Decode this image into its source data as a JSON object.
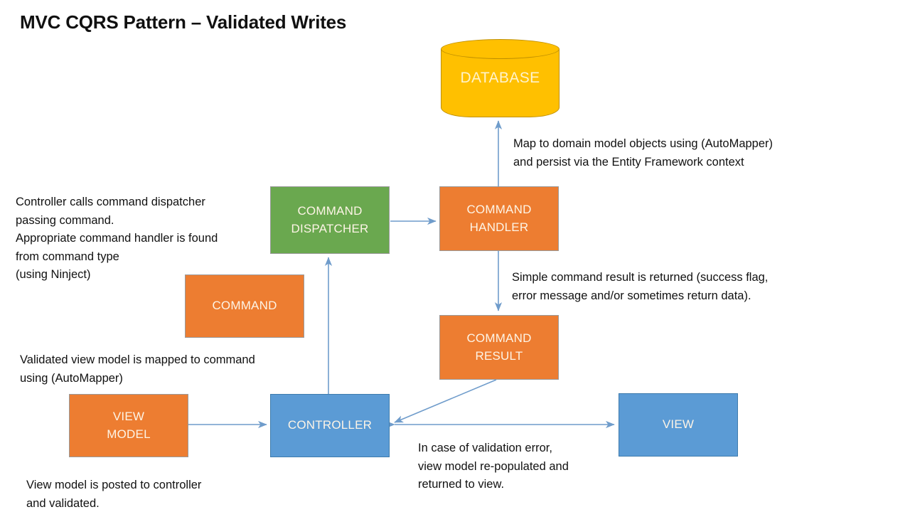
{
  "title": "MVC CQRS Pattern – Validated Writes",
  "colors": {
    "orange": "#ed7d31",
    "green": "#6aa84f",
    "blue": "#5b9bd5",
    "yellow": "#ffc000",
    "arrow": "#6f9ccb",
    "text_dark": "#111111",
    "node_text": "#fdf4e6"
  },
  "nodes": {
    "database": {
      "label": "DATABASE",
      "shape": "cylinder",
      "color": "#ffc000"
    },
    "command_dispatcher": {
      "line1": "COMMAND",
      "line2": "DISPATCHER",
      "color": "#6aa84f"
    },
    "command_handler": {
      "line1": "COMMAND",
      "line2": "HANDLER",
      "color": "#ed7d31"
    },
    "command": {
      "line1": "COMMAND",
      "color": "#ed7d31"
    },
    "command_result": {
      "line1": "COMMAND",
      "line2": "RESULT",
      "color": "#ed7d31"
    },
    "view_model": {
      "line1": "VIEW",
      "line2": "MODEL",
      "color": "#ed7d31"
    },
    "controller": {
      "line1": "CONTROLLER",
      "color": "#5b9bd5"
    },
    "view": {
      "line1": "VIEW",
      "color": "#5b9bd5"
    }
  },
  "notes": {
    "controller_dispatch": "Controller calls command dispatcher\npassing command.\nAppropriate command handler is found\nfrom command type\n(using Ninject)",
    "persist": "Map to domain model objects using (AutoMapper)\nand persist via the Entity Framework context",
    "result": "Simple command result is returned (success flag,\nerror message and/or sometimes return data).",
    "mapping": "Validated view model is mapped to command\nusing (AutoMapper)",
    "posted": "View model is posted to controller\nand validated.",
    "validation_error": "In case of validation error,\nview model re-populated and\nreturned to view."
  }
}
